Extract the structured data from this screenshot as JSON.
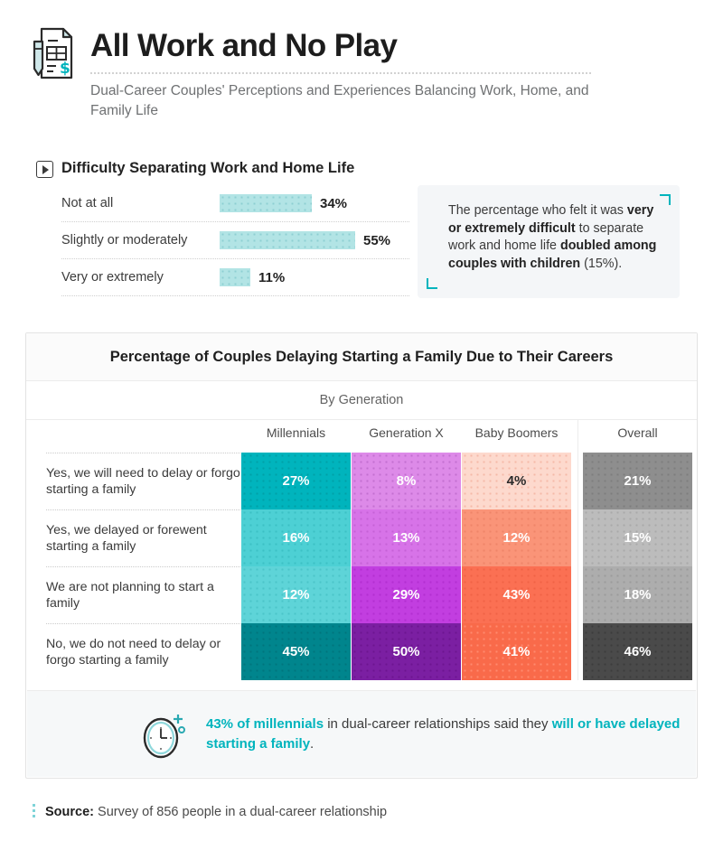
{
  "header": {
    "icon": "document-dollar-icon",
    "title": "All Work and No Play",
    "subtitle": "Dual-Career Couples' Perceptions and Experiences Balancing Work, Home, and Family Life"
  },
  "section1": {
    "icon": "play-square-icon",
    "title": "Difficulty Separating Work and Home Life",
    "callout": {
      "part1": "The percentage who felt it was ",
      "bold1": "very or extremely difficult",
      "part2": " to separate work and home life ",
      "bold2": "doubled among couples with children",
      "part3": " (15%)."
    }
  },
  "table": {
    "title": "Percentage of Couples Delaying Starting a Family Due to Their Careers",
    "subtitle": "By Generation",
    "columns": [
      "Millennials",
      "Generation X",
      "Baby Boomers",
      "Overall"
    ],
    "rows": [
      "Yes, we will need to delay or forgo starting a family",
      "Yes, we delayed or forewent starting a family",
      "We are not planning to start a family",
      "No, we do not need to delay or forgo starting a family"
    ],
    "values": [
      [
        "27%",
        "8%",
        "4%",
        "21%"
      ],
      [
        "16%",
        "13%",
        "12%",
        "15%"
      ],
      [
        "12%",
        "29%",
        "43%",
        "18%"
      ],
      [
        "45%",
        "50%",
        "41%",
        "46%"
      ]
    ]
  },
  "footer": {
    "icon": "clock-icon",
    "highlight1": "43% of millennials",
    "plain1": " in dual-career relationships said they ",
    "highlight2": "will or have delayed starting a family",
    "plain2": "."
  },
  "source": {
    "icon": "source-dots-icon",
    "label": "Source:",
    "text": " Survey of 856 people in a dual-career relationship"
  },
  "colors": {
    "teal": "#00b4bd",
    "bar_fill": "#b2e4e5",
    "panel_bg": "#f4f6f8"
  },
  "chart_data": [
    {
      "type": "bar",
      "title": "Difficulty Separating Work and Home Life",
      "orientation": "horizontal",
      "categories": [
        "Not at all",
        "Slightly or moderately",
        "Very or extremely"
      ],
      "values": [
        34,
        55,
        11
      ],
      "labels": [
        "34%",
        "55%",
        "11%"
      ],
      "unit": "percent",
      "xlabel": "",
      "ylabel": "",
      "xlim": [
        0,
        60
      ],
      "grid": false,
      "legend": "none",
      "series_color": "#b2e4e5"
    },
    {
      "type": "heatmap",
      "title": "Percentage of Couples Delaying Starting a Family Due to Their Careers",
      "subtitle": "By Generation",
      "categories": [
        "Millennials",
        "Generation X",
        "Baby Boomers",
        "Overall"
      ],
      "rows": [
        "Yes, we will need to delay or forgo starting a family",
        "Yes, we delayed or forewent starting a family",
        "We are not planning to start a family",
        "No, we do not need to delay or forgo starting a family"
      ],
      "values": [
        [
          27,
          8,
          4,
          21
        ],
        [
          16,
          13,
          12,
          15
        ],
        [
          12,
          29,
          43,
          18
        ],
        [
          45,
          50,
          41,
          46
        ]
      ],
      "unit": "percent",
      "column_palettes": {
        "Millennials": [
          "#00b4bd",
          "#4dd0d4",
          "#5ed4d8",
          "#00858d"
        ],
        "Generation X": [
          "#dd8ae8",
          "#d773e8",
          "#c23ee0",
          "#7b1fa2"
        ],
        "Baby Boomers": [
          "#fdd9cd",
          "#fa9478",
          "#fb7053",
          "#f96a4a"
        ],
        "Overall": [
          "#8e8e8e",
          "#bcbcbc",
          "#adadad",
          "#4a4a4a"
        ]
      },
      "legend": "none",
      "grid": false
    }
  ],
  "cell_styles": [
    [
      {
        "bg": "#00b4bd",
        "dot": "#00a0a8",
        "text": "light"
      },
      {
        "bg": "#dd8ae8",
        "dot": "#c26fd0",
        "text": "light"
      },
      {
        "bg": "#fdd9cd",
        "dot": "#f5b9a8",
        "text": "dark"
      },
      {
        "bg": "#8e8e8e",
        "dot": "#7d7d7d",
        "text": "light"
      }
    ],
    [
      {
        "bg": "#4dd0d4",
        "dot": "#3cc0c4",
        "text": "light"
      },
      {
        "bg": "#d773e8",
        "dot": "#c560d6",
        "text": "light"
      },
      {
        "bg": "#fa9478",
        "dot": "#ef8468",
        "text": "light"
      },
      {
        "bg": "#bcbcbc",
        "dot": "#a9a9a9",
        "text": "light"
      }
    ],
    [
      {
        "bg": "#5ed4d8",
        "dot": "#4ac4c8",
        "text": "light"
      },
      {
        "bg": "#c23ee0",
        "dot": "#b22ed0",
        "text": "light"
      },
      {
        "bg": "#fb7053",
        "dot": "#f06246",
        "text": "light"
      },
      {
        "bg": "#adadad",
        "dot": "#9b9b9b",
        "text": "light"
      }
    ],
    [
      {
        "bg": "#00858d",
        "dot": "#00757d",
        "text": "light"
      },
      {
        "bg": "#7b1fa2",
        "dot": "#6c1590",
        "text": "light"
      },
      {
        "bg": "#f96a4a",
        "dot": "#ff8a6e",
        "text": "light"
      },
      {
        "bg": "#4a4a4a",
        "dot": "#3c3c3c",
        "text": "light"
      }
    ]
  ]
}
